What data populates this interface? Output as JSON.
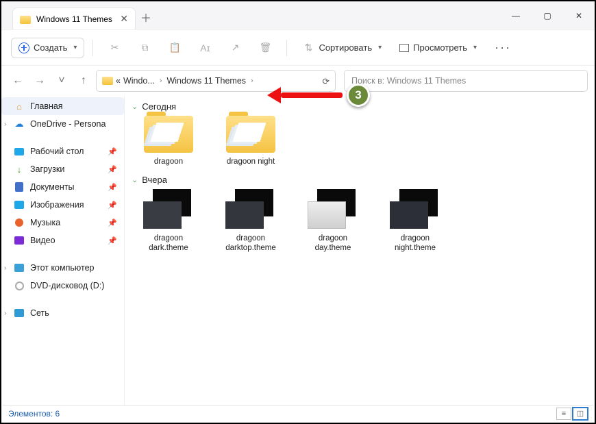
{
  "tab": {
    "title": "Windows 11 Themes"
  },
  "toolbar": {
    "create": "Создать",
    "sort": "Сортировать",
    "view": "Просмотреть"
  },
  "breadcrumb": {
    "part1": "Windo...",
    "part2": "Windows 11 Themes"
  },
  "search": {
    "placeholder": "Поиск в: Windows 11 Themes"
  },
  "annotation": {
    "step": "3"
  },
  "sidebar": {
    "home": "Главная",
    "onedrive": "OneDrive - Persona",
    "desktop": "Рабочий стол",
    "downloads": "Загрузки",
    "documents": "Документы",
    "pictures": "Изображения",
    "music": "Музыка",
    "video": "Видео",
    "thispc": "Этот компьютер",
    "dvd": "DVD-дисковод (D:)",
    "network": "Сеть"
  },
  "groups": {
    "today": "Сегодня",
    "yesterday": "Вчера"
  },
  "items": {
    "folders": [
      "dragoon",
      "dragoon night"
    ],
    "themes": [
      {
        "label": "dragoon\ndark.theme",
        "cls": "c-dark"
      },
      {
        "label": "dragoon\ndarktop.theme",
        "cls": "c-top"
      },
      {
        "label": "dragoon\nday.theme",
        "cls": "c-day"
      },
      {
        "label": "dragoon\nnight.theme",
        "cls": "c-night"
      }
    ]
  },
  "status": {
    "count_label": "Элементов:",
    "count": "6"
  }
}
